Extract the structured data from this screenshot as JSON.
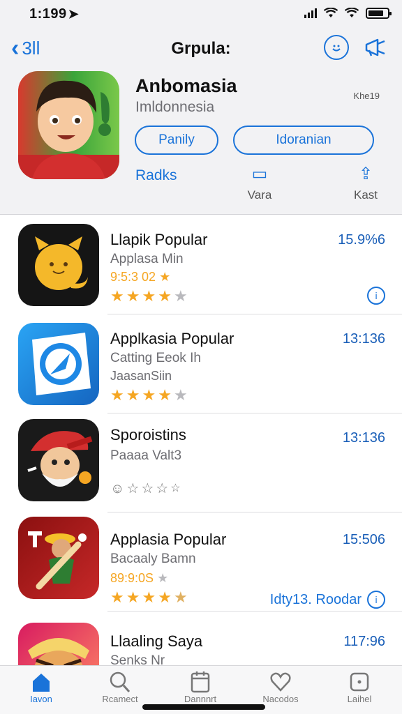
{
  "status_bar": {
    "time": "1:199",
    "location_arrow": "location-arrow-icon"
  },
  "nav": {
    "back_label": "3ll",
    "title": "Grpula:"
  },
  "app": {
    "name": "Anbomasia",
    "subtitle": "Imldonnesia",
    "extra": "Khe19",
    "pill_left": "Panily",
    "pill_right": "Idoranian",
    "link": "Radks",
    "action_1": "Vara",
    "action_2": "Kast"
  },
  "list": [
    {
      "title": "Llapik Popular",
      "subtitle": "Applasa Min",
      "subtitle2": "9:5:3 02",
      "size": "15.9%6",
      "rating_stars": 4,
      "has_info": true,
      "link": ""
    },
    {
      "title": "Applkasia Popular",
      "subtitle": "Catting Eeok Ih",
      "subtitle2": "JaasanSiin",
      "size": "13:136",
      "rating_stars": 4,
      "has_info": false,
      "link": ""
    },
    {
      "title": "Sporoistins",
      "subtitle": "Paaaa Valt3",
      "subtitle2": "",
      "size": "13:136",
      "rating_stars": 0,
      "has_info": false,
      "link": ""
    },
    {
      "title": "Applasia Popular",
      "subtitle": "Bacaaly Bamn",
      "subtitle2": "89:9:0S",
      "size": "15:506",
      "rating_stars": 4.5,
      "has_info": true,
      "link": "Idty13. Roodar"
    },
    {
      "title": "Llaaling Saya",
      "subtitle": "Senks Nr",
      "subtitle2": "",
      "size": "117:96",
      "rating_stars": 0,
      "has_info": false,
      "link": ""
    }
  ],
  "tabs": [
    {
      "label": "Iavon",
      "icon": "home-icon",
      "active": true
    },
    {
      "label": "Rcamect",
      "icon": "search-icon",
      "active": false
    },
    {
      "label": "Dannnrt",
      "icon": "calendar-icon",
      "active": false
    },
    {
      "label": "Nacodos",
      "icon": "heart-icon",
      "active": false
    },
    {
      "label": "Laihel",
      "icon": "square-dot-icon",
      "active": false
    }
  ],
  "colors": {
    "accent": "#1a73d9",
    "star": "#f5a623",
    "size_text": "#1a5fb8"
  }
}
